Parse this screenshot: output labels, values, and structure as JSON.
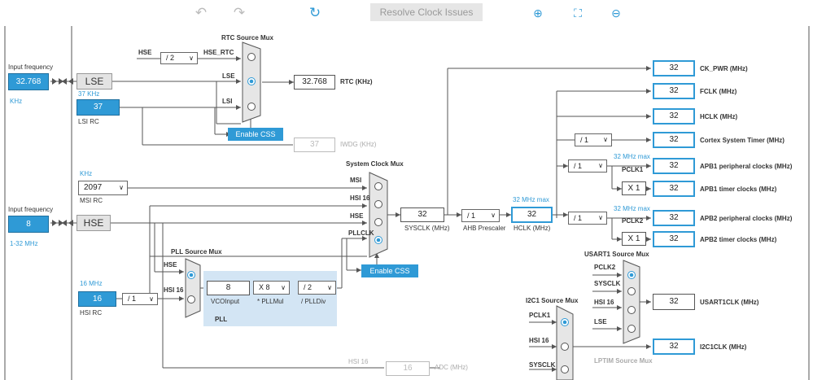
{
  "toolbar": {
    "undo_icon": "undo-icon",
    "redo_icon": "redo-icon",
    "refresh_icon": "refresh-icon",
    "resolve_label": "Resolve Clock Issues",
    "zoom_in_icon": "zoom-in-icon",
    "fit_icon": "fit-icon",
    "zoom_out_icon": "zoom-out-icon"
  },
  "lse": {
    "input_label": "Input frequency",
    "value": "32.768",
    "unit": "KHz",
    "box": "LSE"
  },
  "lsi": {
    "freq": "37 KHz",
    "value": "37",
    "label": "LSI RC"
  },
  "rtc_mux": {
    "title": "RTC Source Mux",
    "in_hse_rtc": "HSE_RTC",
    "in_lse": "LSE",
    "in_lsi": "LSI",
    "hse": "HSE",
    "div": "/ 2",
    "out_value": "32.768",
    "out_label": "RTC (KHz)",
    "css_button": "Enable CSS",
    "iwdg_value": "37",
    "iwdg_label": "IWDG (KHz)"
  },
  "msi": {
    "unit": "KHz",
    "value": "2097",
    "label": "MSI RC"
  },
  "hse": {
    "input_label": "Input frequency",
    "value": "8",
    "range": "1-32 MHz",
    "box": "HSE"
  },
  "hsi": {
    "freq": "16 MHz",
    "value": "16",
    "label": "HSI RC",
    "div": "/ 1"
  },
  "pll": {
    "mux_title": "PLL Source Mux",
    "in_hse": "HSE",
    "in_hsi": "HSI 16",
    "vco_value": "8",
    "vco_label": "VCOInput",
    "mul": "X 8",
    "mul_label": "* PLLMul",
    "div": "/ 2",
    "div_label": "/ PLLDiv",
    "title": "PLL"
  },
  "sys_mux": {
    "title": "System Clock Mux",
    "in_msi": "MSI",
    "in_hsi": "HSI 16",
    "in_hse": "HSE",
    "in_pll": "PLLCLK",
    "css_button": "Enable CSS",
    "sysclk": "32",
    "sysclk_label": "SYSCLK (MHz)"
  },
  "ahb": {
    "presc": "/ 1",
    "presc_label": "AHB Prescaler",
    "max": "32 MHz max",
    "hclk": "32",
    "hclk_label": "HCLK (MHz)"
  },
  "outputs": {
    "ck_pwr": "32",
    "ck_pwr_label": "CK_PWR (MHz)",
    "fclk": "32",
    "fclk_label": "FCLK (MHz)",
    "hclk": "32",
    "hclk_label": "HCLK (MHz)",
    "cortex_div": "/ 1",
    "cortex": "32",
    "cortex_label": "Cortex System Timer (MHz)"
  },
  "apb1": {
    "max": "32 MHz max",
    "div": "/ 1",
    "pclk": "PCLK1",
    "periph": "32",
    "periph_label": "APB1 peripheral clocks (MHz)",
    "mult": "X 1",
    "timer": "32",
    "timer_label": "APB1 timer clocks (MHz)"
  },
  "apb2": {
    "max": "32 MHz max",
    "div": "/ 1",
    "pclk": "PCLK2",
    "periph": "32",
    "periph_label": "APB2 peripheral clocks (MHz)",
    "mult": "X 1",
    "timer": "32",
    "timer_label": "APB2 timer clocks (MHz)"
  },
  "usart": {
    "title": "USART1 Source Mux",
    "in1": "PCLK2",
    "in2": "SYSCLK",
    "in3": "HSI 16",
    "in4": "LSE",
    "value": "32",
    "label": "USART1CLK (MHz)"
  },
  "i2c": {
    "title": "I2C1 Source Mux",
    "in1": "PCLK1",
    "in2": "HSI 16",
    "in3": "SYSCLK",
    "value": "32",
    "label": "I2C1CLK (MHz)"
  },
  "lptim": {
    "title": "LPTIM Source Mux"
  },
  "adc": {
    "in": "HSI 16",
    "value": "16",
    "label": "ADC (MHz)"
  },
  "colors": {
    "accent": "#2f9ad6",
    "line": "#555555"
  }
}
